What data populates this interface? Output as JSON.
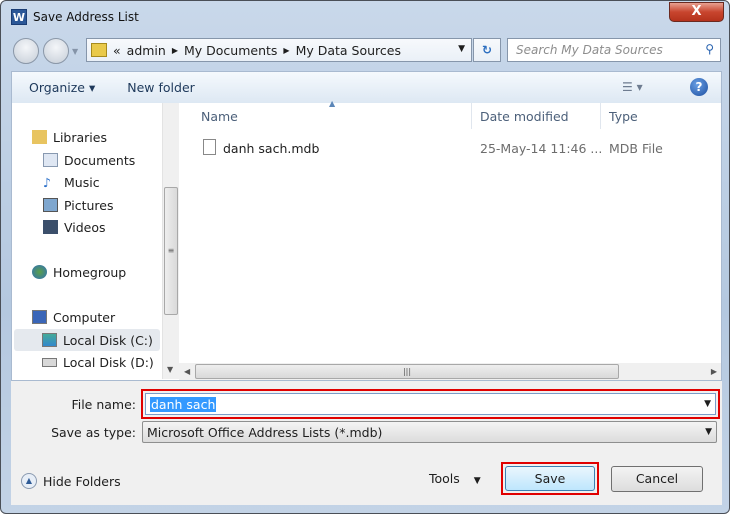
{
  "window": {
    "title": "Save Address List",
    "app_icon": "W",
    "close_label": "X"
  },
  "nav": {
    "breadcrumb": [
      "admin",
      "My Documents",
      "My Data Sources"
    ],
    "overflow": "«",
    "search_placeholder": "Search My Data Sources"
  },
  "toolbar": {
    "organize": "Organize ▾",
    "new_folder": "New folder",
    "help": "?"
  },
  "sidebar": {
    "items": [
      {
        "label": "Libraries",
        "icon": "libraries-icon"
      },
      {
        "label": "Documents",
        "icon": "documents-icon"
      },
      {
        "label": "Music",
        "icon": "music-icon"
      },
      {
        "label": "Pictures",
        "icon": "pictures-icon"
      },
      {
        "label": "Videos",
        "icon": "videos-icon"
      },
      {
        "label": "Homegroup",
        "icon": "homegroup-icon"
      },
      {
        "label": "Computer",
        "icon": "computer-icon"
      },
      {
        "label": "Local Disk (C:)",
        "icon": "drive-icon"
      },
      {
        "label": "Local Disk (D:)",
        "icon": "drive-icon"
      }
    ]
  },
  "columns": [
    "Name",
    "Date modified",
    "Type"
  ],
  "files": [
    {
      "name": "danh sach.mdb",
      "date": "25-May-14 11:46 ...",
      "type": "MDB File"
    }
  ],
  "form": {
    "file_name_label": "File name:",
    "file_name_value": "danh sach",
    "save_type_label": "Save as type:",
    "save_type_value": "Microsoft Office Address Lists (*.mdb)"
  },
  "footer": {
    "hide_folders": "Hide Folders",
    "tools": "Tools",
    "save": "Save",
    "cancel": "Cancel"
  },
  "colors": {
    "highlight": "#e00000",
    "selection": "#3399ff"
  }
}
